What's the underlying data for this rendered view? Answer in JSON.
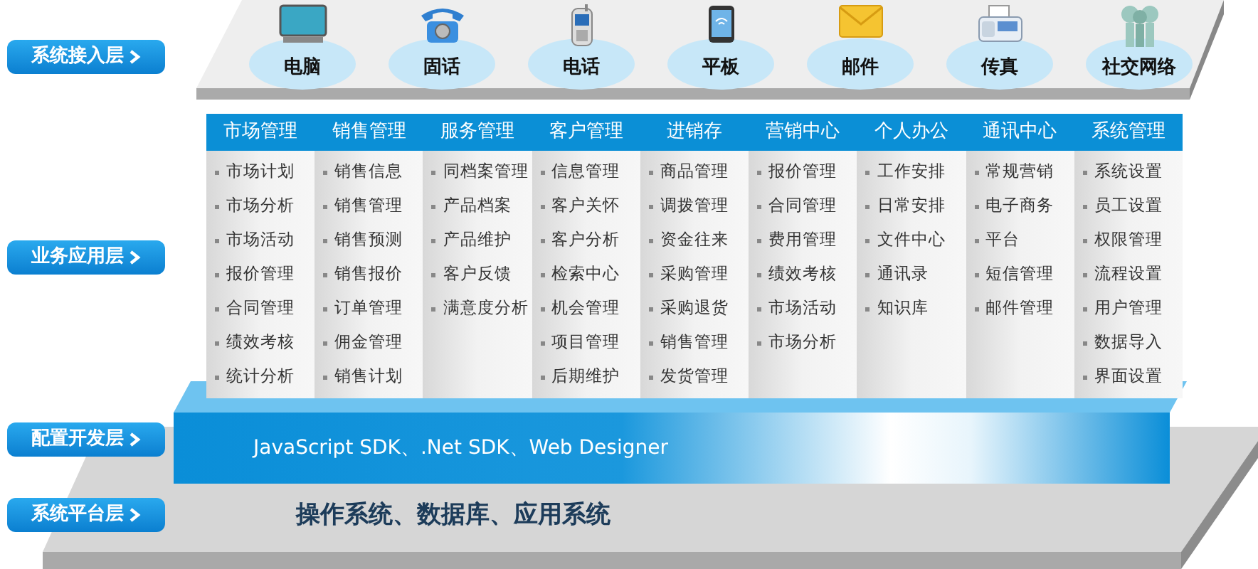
{
  "layers": [
    "系统接入层",
    "业务应用层",
    "配置开发层",
    "系统平台层"
  ],
  "devices": [
    {
      "kind": "computer",
      "label": "电脑"
    },
    {
      "kind": "desk-phone",
      "label": "固话"
    },
    {
      "kind": "mobile",
      "label": "电话"
    },
    {
      "kind": "tablet",
      "label": "平板"
    },
    {
      "kind": "mail",
      "label": "邮件"
    },
    {
      "kind": "fax",
      "label": "传真"
    },
    {
      "kind": "social",
      "label": "社交网络"
    }
  ],
  "modules": [
    {
      "title": "市场管理",
      "items": [
        "市场计划",
        "市场分析",
        "市场活动",
        "报价管理",
        "合同管理",
        "绩效考核",
        "统计分析"
      ]
    },
    {
      "title": "销售管理",
      "items": [
        "销售信息",
        "销售管理",
        "销售预测",
        "销售报价",
        "订单管理",
        "佣金管理",
        "销售计划"
      ]
    },
    {
      "title": "服务管理",
      "items": [
        "同档案管理",
        "产品档案",
        "产品维护",
        "客户反馈",
        "满意度分析"
      ]
    },
    {
      "title": "客户管理",
      "items": [
        "信息管理",
        "客户关怀",
        "客户分析",
        "检索中心",
        "机会管理",
        "项目管理",
        "后期维护"
      ]
    },
    {
      "title": "进销存",
      "items": [
        "商品管理",
        "调拨管理",
        "资金往来",
        "采购管理",
        "采购退货",
        "销售管理",
        "发货管理"
      ]
    },
    {
      "title": "营销中心",
      "items": [
        "报价管理",
        "合同管理",
        "费用管理",
        "绩效考核",
        "市场活动",
        "市场分析"
      ]
    },
    {
      "title": "个人办公",
      "items": [
        "工作安排",
        "日常安排",
        "文件中心",
        "通讯录",
        "知识库"
      ]
    },
    {
      "title": "通讯中心",
      "items": [
        "常规营销",
        "电子商务",
        "平台",
        "短信管理",
        "邮件管理"
      ]
    },
    {
      "title": "系统管理",
      "items": [
        "系统设置",
        "员工设置",
        "权限管理",
        "流程设置",
        "用户管理",
        "数据导入",
        "界面设置"
      ]
    }
  ],
  "dev_layer": {
    "text": "JavaScript SDK、.Net SDK、Web Designer"
  },
  "platform_layer": {
    "text": "操作系统、数据库、应用系统"
  }
}
